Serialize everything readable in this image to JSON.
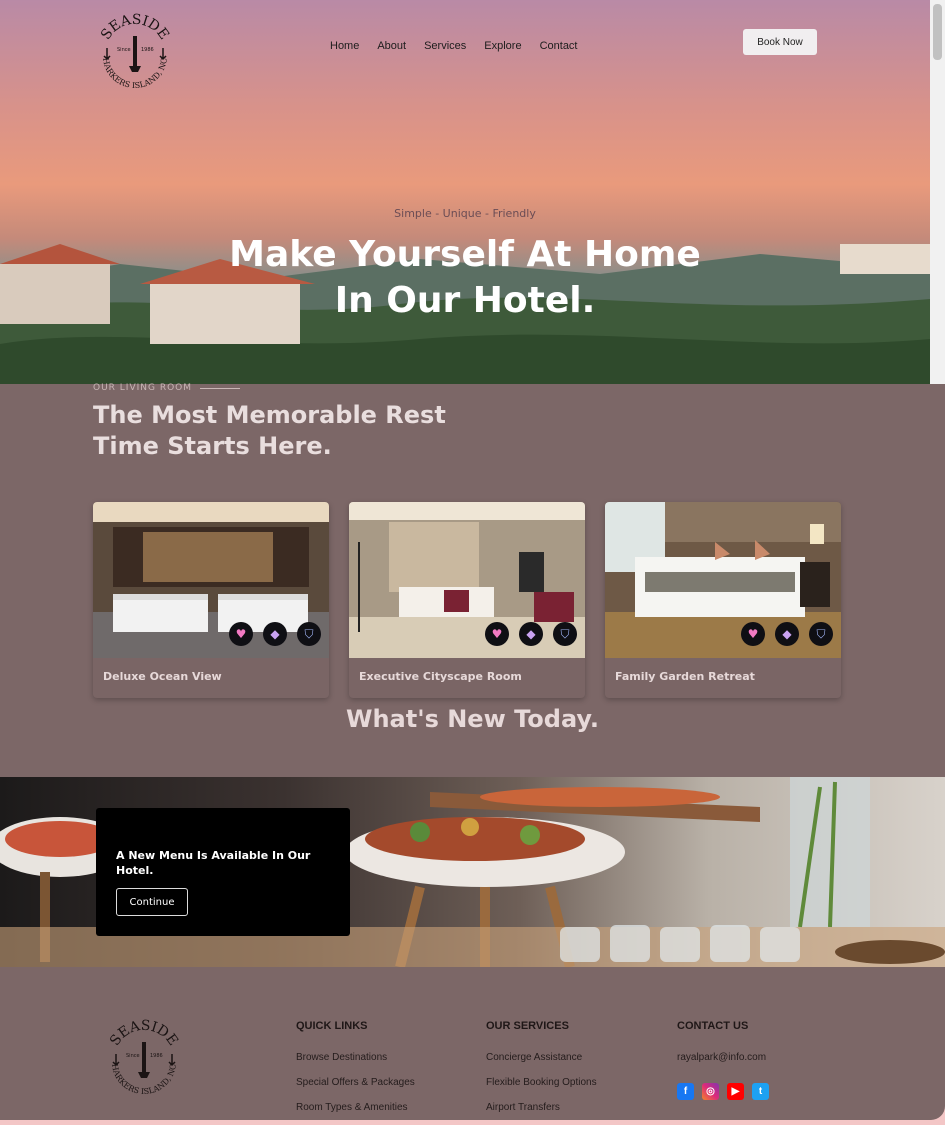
{
  "brand": {
    "logo_top": "SEASIDE",
    "logo_since": "Since",
    "logo_year": "1986",
    "logo_bottom": "HARKERS ISLAND, NC"
  },
  "nav": {
    "items": [
      "Home",
      "About",
      "Services",
      "Explore",
      "Contact"
    ],
    "book_label": "Book Now"
  },
  "hero": {
    "tagline": "Simple - Unique - Friendly",
    "title_line1": "Make Yourself At Home",
    "title_line2": "In Our Hotel."
  },
  "rooms": {
    "eyebrow": "OUR LIVING ROOM",
    "title_line1": "The Most Memorable Rest",
    "title_line2": "Time Starts Here.",
    "cards": [
      {
        "title": "Deluxe Ocean View"
      },
      {
        "title": "Executive Cityscape Room"
      },
      {
        "title": "Family Garden Retreat"
      }
    ],
    "card_icons": [
      "heart-icon",
      "paint-bucket-icon",
      "shield-icon"
    ]
  },
  "news": {
    "title": "What's New Today.",
    "promo_text": "A New Menu Is Available In Our Hotel.",
    "continue_label": "Continue"
  },
  "footer": {
    "quick_links": {
      "heading": "QUICK LINKS",
      "items": [
        "Browse Destinations",
        "Special Offers & Packages",
        "Room Types & Amenities"
      ]
    },
    "services": {
      "heading": "OUR SERVICES",
      "items": [
        "Concierge Assistance",
        "Flexible Booking Options",
        "Airport Transfers"
      ]
    },
    "contact": {
      "heading": "CONTACT US",
      "email": "rayalpark@info.com",
      "social": [
        "facebook-icon",
        "instagram-icon",
        "youtube-icon",
        "twitter-icon"
      ]
    }
  },
  "colors": {
    "page_bg": "#7c6767",
    "outer_bg": "#f3c6c6",
    "heading_light": "#e9dede",
    "promo_bg": "#000000"
  }
}
